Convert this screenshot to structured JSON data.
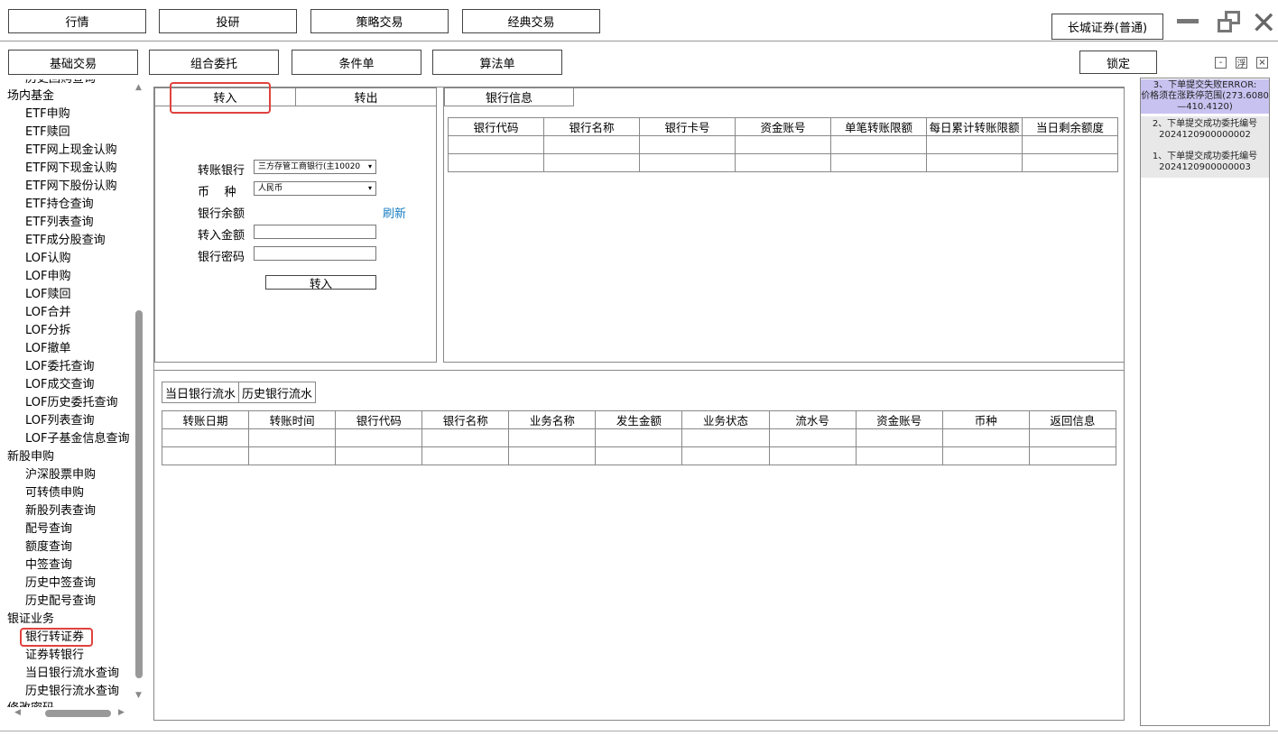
{
  "top_nav": {
    "market": "行情",
    "research": "投研",
    "strategy": "策略交易",
    "classic": "经典交易",
    "broker": "长城证券(普通)"
  },
  "sub_nav": {
    "basic": "基础交易",
    "combo": "组合委托",
    "condition": "条件单",
    "algo": "算法单",
    "lock": "锁定"
  },
  "small_controls": {
    "minimize": "-",
    "float": "浮",
    "close": "×"
  },
  "sidebar": {
    "clipped_top": "历史回购查询",
    "clipped_bottom": "修改密码",
    "groups": [
      {
        "label": "场内基金",
        "items": [
          "ETF申购",
          "ETF赎回",
          "ETF网上现金认购",
          "ETF网下现金认购",
          "ETF网下股份认购",
          "ETF持仓查询",
          "ETF列表查询",
          "ETF成分股查询",
          "LOF认购",
          "LOF申购",
          "LOF赎回",
          "LOF合并",
          "LOF分拆",
          "LOF撤单",
          "LOF委托查询",
          "LOF成交查询",
          "LOF历史委托查询",
          "LOF列表查询",
          "LOF子基金信息查询"
        ]
      },
      {
        "label": "新股申购",
        "items": [
          "沪深股票申购",
          "可转债申购",
          "新股列表查询",
          "配号查询",
          "额度查询",
          "中签查询",
          "历史中签查询",
          "历史配号查询"
        ]
      },
      {
        "label": "银证业务",
        "items": [
          "银行转证券",
          "证券转银行",
          "当日银行流水查询",
          "历史银行流水查询"
        ]
      }
    ]
  },
  "transfer": {
    "tab_in": "转入",
    "tab_out": "转出",
    "bank_label": "转账银行",
    "bank_value": "三方存管工商银行(主10020",
    "currency_label": "币    种",
    "currency_value": "人民币",
    "balance_label": "银行余额",
    "refresh": "刷新",
    "amount_label": "转入金额",
    "password_label": "银行密码",
    "submit": "转入"
  },
  "bank_info": {
    "tab": "银行信息",
    "columns": [
      "银行代码",
      "银行名称",
      "银行卡号",
      "资金账号",
      "单笔转账限额",
      "每日累计转账限额",
      "当日剩余额度"
    ]
  },
  "flow": {
    "tab_today": "当日银行流水",
    "tab_history": "历史银行流水",
    "columns": [
      "转账日期",
      "转账时间",
      "银行代码",
      "银行名称",
      "业务名称",
      "发生金额",
      "业务状态",
      "流水号",
      "资金账号",
      "币种",
      "返回信息"
    ]
  },
  "notices": [
    {
      "line1": "3、下单提交失败ERROR:",
      "line2": "价格须在涨跌停范围(273.6080",
      "line3": "—410.4120)"
    },
    {
      "line1": "2、下单提交成功委托编号",
      "line2": "2024120900000002"
    },
    {
      "line1": "1、下单提交成功委托编号",
      "line2": "2024120900000003"
    }
  ],
  "colors": {
    "highlight": "#e0423e",
    "link": "#1a7fc4",
    "error_bg": "#c8c2f0",
    "notice_bg": "#e8e8e8"
  }
}
